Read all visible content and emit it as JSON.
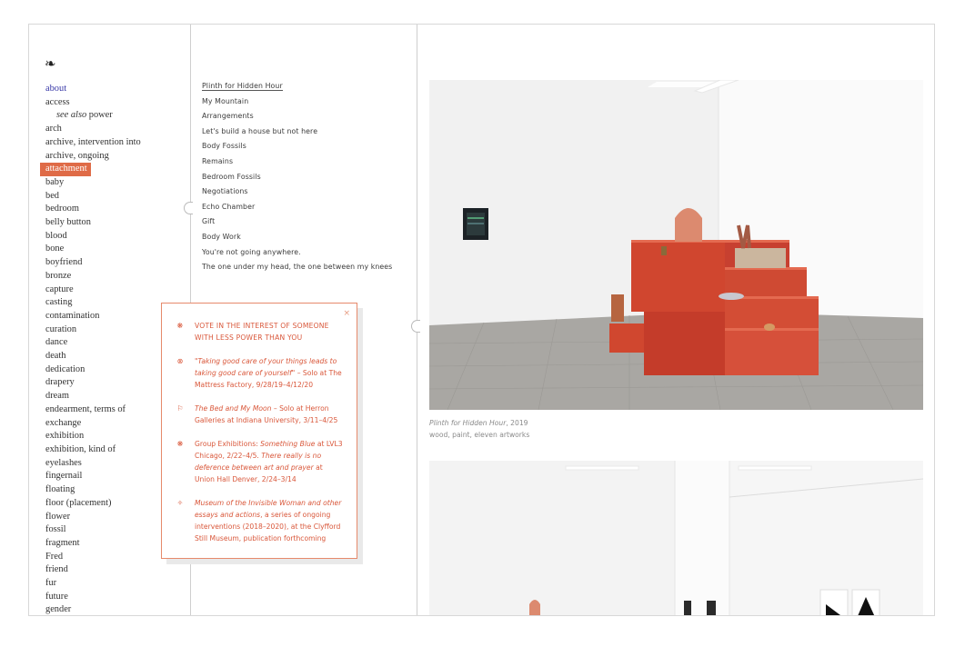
{
  "index": {
    "fleuron": "❧",
    "items": [
      {
        "label": "about",
        "kind": "link"
      },
      {
        "label": "access",
        "kind": "plain"
      },
      {
        "label": "see also power",
        "kind": "sub"
      },
      {
        "label": "arch",
        "kind": "plain"
      },
      {
        "label": "archive, intervention into",
        "kind": "plain"
      },
      {
        "label": "archive, ongoing",
        "kind": "plain"
      },
      {
        "label": "attachment",
        "kind": "active"
      },
      {
        "label": "baby",
        "kind": "plain"
      },
      {
        "label": "bed",
        "kind": "plain"
      },
      {
        "label": "bedroom",
        "kind": "plain"
      },
      {
        "label": "belly button",
        "kind": "plain"
      },
      {
        "label": "blood",
        "kind": "plain"
      },
      {
        "label": "bone",
        "kind": "plain"
      },
      {
        "label": "boyfriend",
        "kind": "plain"
      },
      {
        "label": "bronze",
        "kind": "plain"
      },
      {
        "label": "capture",
        "kind": "plain"
      },
      {
        "label": "casting",
        "kind": "plain"
      },
      {
        "label": "contamination",
        "kind": "plain"
      },
      {
        "label": "curation",
        "kind": "plain"
      },
      {
        "label": "dance",
        "kind": "plain"
      },
      {
        "label": "death",
        "kind": "plain"
      },
      {
        "label": "dedication",
        "kind": "plain"
      },
      {
        "label": "drapery",
        "kind": "plain"
      },
      {
        "label": "dream",
        "kind": "plain"
      },
      {
        "label": "endearment, terms of",
        "kind": "plain"
      },
      {
        "label": "exchange",
        "kind": "plain"
      },
      {
        "label": "exhibition",
        "kind": "plain"
      },
      {
        "label": "exhibition, kind of",
        "kind": "plain"
      },
      {
        "label": "eyelashes",
        "kind": "plain"
      },
      {
        "label": "fingernail",
        "kind": "plain"
      },
      {
        "label": "floating",
        "kind": "plain"
      },
      {
        "label": "floor (placement)",
        "kind": "plain"
      },
      {
        "label": "flower",
        "kind": "plain"
      },
      {
        "label": "fossil",
        "kind": "plain"
      },
      {
        "label": "fragment",
        "kind": "plain"
      },
      {
        "label": "Fred",
        "kind": "plain"
      },
      {
        "label": "friend",
        "kind": "plain"
      },
      {
        "label": "fur",
        "kind": "plain"
      },
      {
        "label": "future",
        "kind": "plain"
      },
      {
        "label": "gender",
        "kind": "plain"
      }
    ]
  },
  "works": [
    {
      "label": "Plinth for Hidden Hour",
      "current": true
    },
    {
      "label": "My Mountain",
      "current": false
    },
    {
      "label": "Arrangements",
      "current": false
    },
    {
      "label": "Let's build a house but not here",
      "current": false
    },
    {
      "label": "Body Fossils",
      "current": false
    },
    {
      "label": "Remains",
      "current": false
    },
    {
      "label": "Bedroom Fossils",
      "current": false
    },
    {
      "label": "Negotiations",
      "current": false
    },
    {
      "label": "Echo Chamber",
      "current": false
    },
    {
      "label": "Gift",
      "current": false
    },
    {
      "label": "Body Work",
      "current": false
    },
    {
      "label": "You're not going anywhere.",
      "current": false
    },
    {
      "label": "The one under my head, the one between my knees",
      "current": false
    }
  ],
  "popup": {
    "close": "×",
    "entries": [
      {
        "bullet": "❋",
        "upper": true,
        "parts": [
          {
            "t": "VOTE IN THE INTEREST OF SOMEONE WITH LESS POWER THAN YOU",
            "i": false
          }
        ]
      },
      {
        "bullet": "⊗",
        "upper": false,
        "parts": [
          {
            "t": "\"Taking good care of your things leads to taking good care of yourself\"",
            "i": true
          },
          {
            "t": " – Solo at The Mattress Factory, 9/28/19–4/12/20",
            "i": false
          }
        ]
      },
      {
        "bullet": "⚐",
        "upper": false,
        "parts": [
          {
            "t": "The Bed and My Moon",
            "i": true
          },
          {
            "t": " – Solo at Herron Galleries at Indiana University, 3/11–4/25",
            "i": false
          }
        ]
      },
      {
        "bullet": "❋",
        "upper": false,
        "parts": [
          {
            "t": "Group Exhibitions: ",
            "i": false
          },
          {
            "t": "Something Blue",
            "i": true
          },
          {
            "t": " at LVL3 Chicago, 2/22–4/5. ",
            "i": false
          },
          {
            "t": " There really is no deference between art and prayer",
            "i": true
          },
          {
            "t": " at Union Hall Denver, 2/24–3/14",
            "i": false
          }
        ]
      },
      {
        "bullet": "✧",
        "upper": false,
        "parts": [
          {
            "t": "Museum of the Invisible Woman and other essays and actions",
            "i": true
          },
          {
            "t": ", a series of ongoing interventions (2018–2020), at the Clyfford Still Museum, publication forthcoming",
            "i": false
          }
        ]
      }
    ]
  },
  "image_caption": {
    "title": "Plinth for Hidden Hour",
    "year": ", 2019",
    "medium": "wood, paint, eleven artworks"
  },
  "colors": {
    "accent": "#df6b47",
    "popup_text": "#d9573a",
    "link": "#3a3aa8",
    "plinth": "#d5503a"
  }
}
